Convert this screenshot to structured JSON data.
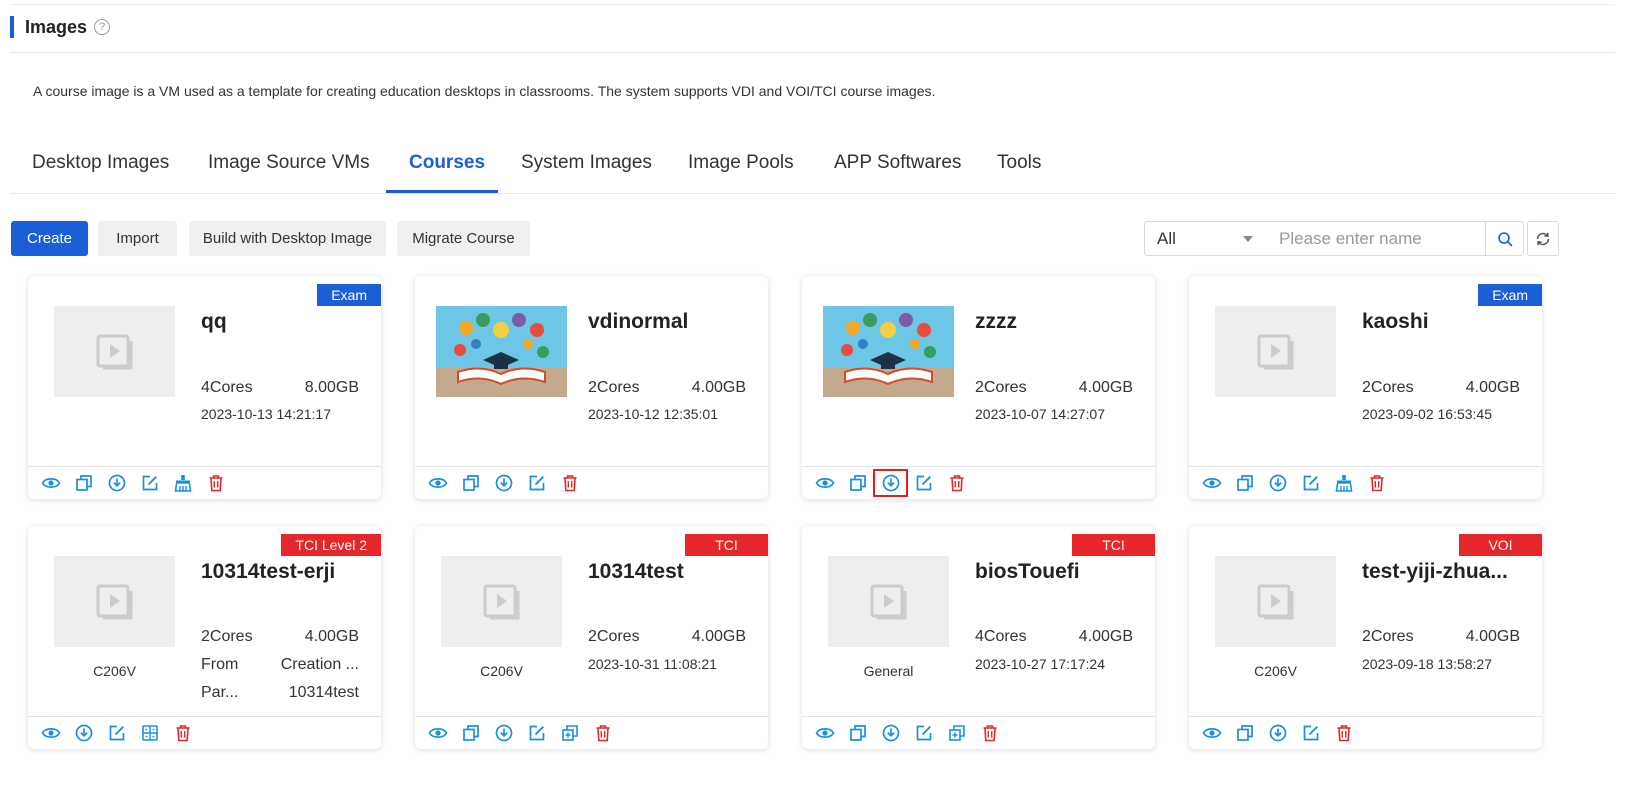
{
  "header": {
    "title": "Images"
  },
  "description": "A course image is a VM used as a template for creating education desktops in classrooms. The system supports VDI and VOI/TCI course images.",
  "tabs": [
    {
      "label": "Desktop Images"
    },
    {
      "label": "Image Source VMs"
    },
    {
      "label": "Courses",
      "active": true
    },
    {
      "label": "System Images"
    },
    {
      "label": "Image Pools"
    },
    {
      "label": "APP Softwares"
    },
    {
      "label": "Tools"
    }
  ],
  "toolbar": {
    "create": "Create",
    "import": "Import",
    "build": "Build with Desktop Image",
    "migrate": "Migrate Course",
    "filter_value": "All",
    "search_placeholder": "Please enter name"
  },
  "colors": {
    "primary": "#1a5fd6",
    "badge_blue": "#1a5fd6",
    "badge_red": "#e5262a",
    "icon_blue": "#1a8fe0",
    "icon_red": "#e5262a"
  },
  "cards": [
    {
      "name": "qq",
      "badge": "Exam",
      "cores": "4Cores",
      "memory": "8.00GB",
      "date": "2023-10-13 14:21:17"
    },
    {
      "name": "vdinormal",
      "cores": "2Cores",
      "memory": "4.00GB",
      "date": "2023-10-12 12:35:01"
    },
    {
      "name": "zzzz",
      "cores": "2Cores",
      "memory": "4.00GB",
      "date": "2023-10-07 14:27:07"
    },
    {
      "name": "kaoshi",
      "badge": "Exam",
      "cores": "2Cores",
      "memory": "4.00GB",
      "date": "2023-09-02 16:53:45"
    },
    {
      "name": "10314test-erji",
      "badge": "TCI Level 2",
      "caption": "C206V",
      "cores": "2Cores",
      "memory": "4.00GB",
      "from_label": "From",
      "from_value": "Creation ...",
      "parent_label": "Par...",
      "parent_value": "10314test"
    },
    {
      "name": "10314test",
      "badge": "TCI",
      "caption": "C206V",
      "cores": "2Cores",
      "memory": "4.00GB",
      "date": "2023-10-31 11:08:21"
    },
    {
      "name": "biosTouefi",
      "badge": "TCI",
      "caption": "General",
      "cores": "4Cores",
      "memory": "4.00GB",
      "date": "2023-10-27 17:17:24"
    },
    {
      "name": "test-yiji-zhua...",
      "badge": "VOI",
      "caption": "C206V",
      "cores": "2Cores",
      "memory": "4.00GB",
      "date": "2023-09-18 13:58:27"
    }
  ]
}
